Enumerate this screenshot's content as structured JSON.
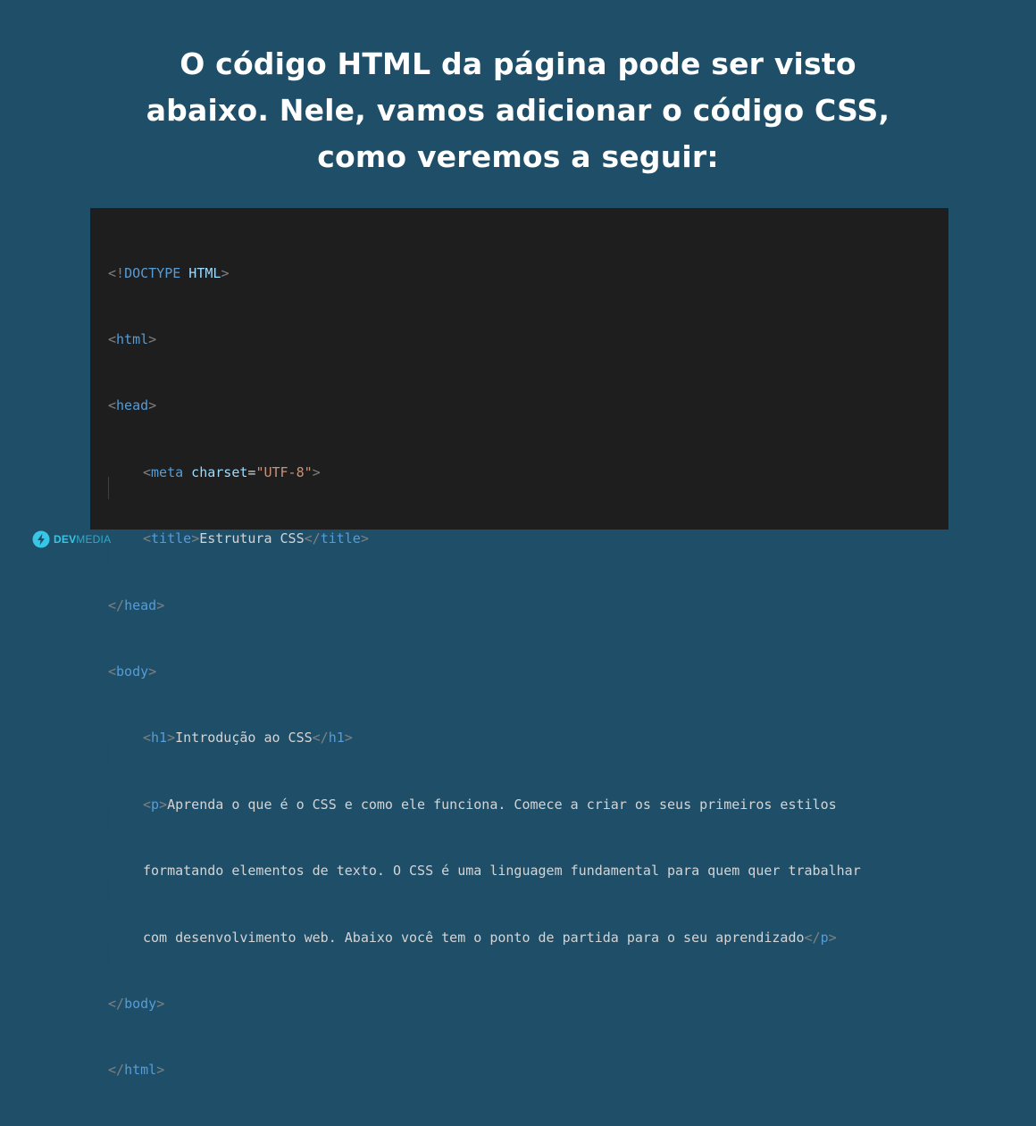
{
  "headline": {
    "line1": "O código HTML da página pode ser visto",
    "line2": "abaixo. Nele, vamos adicionar o código CSS,",
    "line3": "como veremos a seguir:"
  },
  "code": {
    "doctype_open": "<!",
    "doctype_kw": "DOCTYPE",
    "doctype_name": " HTML",
    "doctype_close": ">",
    "html_open": "html",
    "head_open": "head",
    "meta_tag": "meta",
    "meta_attr": " charset",
    "meta_eq": "=",
    "meta_value": "\"UTF-8\"",
    "title_tag": "title",
    "title_text": "Estrutura CSS",
    "head_close": "head",
    "body_open": "body",
    "h1_tag": "h1",
    "h1_text": "Introdução ao CSS",
    "p_tag": "p",
    "p_text_line1": "Aprenda o que é o CSS e como ele funciona. Comece a criar os seus primeiros estilos",
    "p_text_line2": "formatando elementos de texto. O CSS é uma linguagem fundamental para quem quer trabalhar",
    "p_text_line3": "com desenvolvimento web. Abaixo você tem o ponto de partida para o seu aprendizado",
    "body_close": "body",
    "html_close": "html"
  },
  "logo": {
    "brand_bold": "DEV",
    "brand_light": "MEDIA",
    "icon": "devmedia-bolt-icon",
    "color": "#38c6e6"
  },
  "colors": {
    "background": "#1f4f68",
    "code_background": "#1e1e1e",
    "tag": "#569cd6",
    "attribute": "#9cdcfe",
    "string": "#ce9178",
    "punctuation": "#808080",
    "text": "#d4d4d4"
  }
}
